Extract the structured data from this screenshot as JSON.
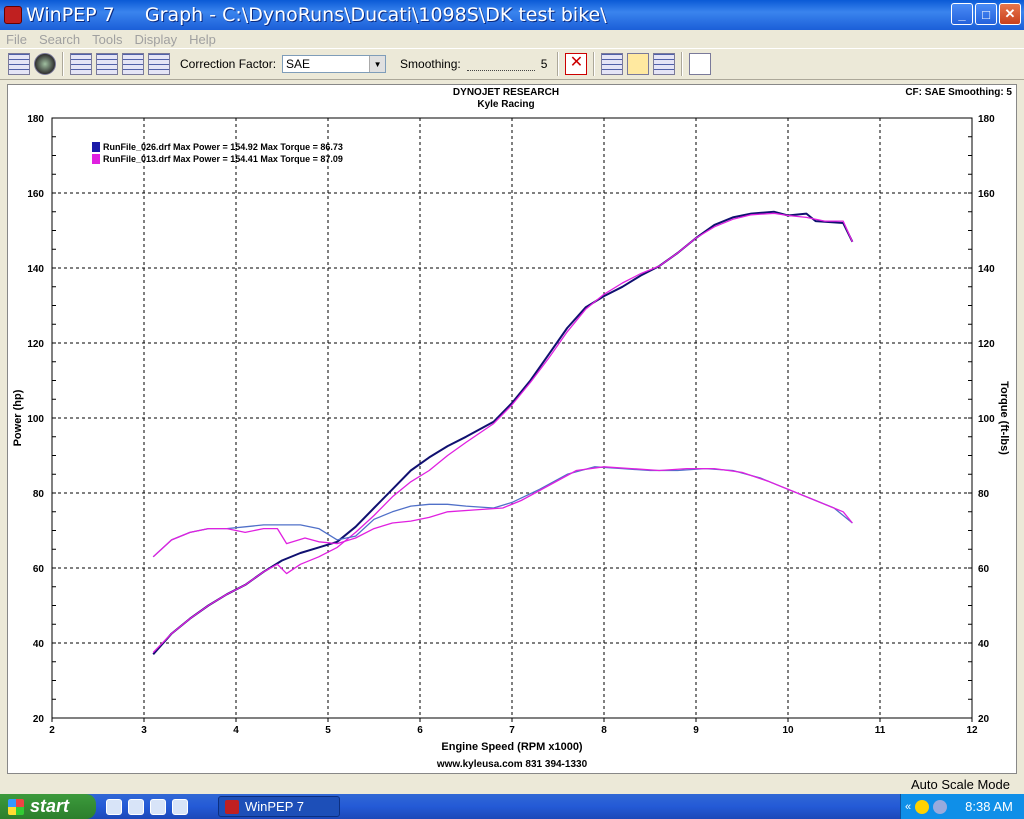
{
  "window": {
    "title": "WinPEP 7     Graph - C:\\DynoRuns\\Ducati\\1098S\\DK test bike\\",
    "minimize": "_",
    "maximize": "□",
    "close": "✕"
  },
  "menu": [
    "File",
    "Search",
    "Tools",
    "Display",
    "Help"
  ],
  "toolbar": {
    "correction_label": "Correction Factor:",
    "correction_value": "SAE",
    "smoothing_label": "Smoothing:",
    "smoothing_value": "5"
  },
  "chart_data": {
    "type": "line",
    "title": "DYNOJET RESEARCH",
    "subtitle": "Kyle Racing",
    "info_right": "CF: SAE  Smoothing: 5",
    "xlabel": "Engine Speed (RPM x1000)",
    "ylabel": "Power (hp)",
    "ylabel_right": "Torque (ft-lbs)",
    "footer": "www.kyleusa.com   831 394-1330",
    "xlim": [
      2,
      12
    ],
    "ylim": [
      20,
      180
    ],
    "xticks": [
      2,
      3,
      4,
      5,
      6,
      7,
      8,
      9,
      10,
      11,
      12
    ],
    "yticks": [
      20,
      40,
      60,
      80,
      100,
      120,
      140,
      160,
      180
    ],
    "grid": true,
    "legend_position": "top-left",
    "legend": [
      {
        "label": "RunFile_026.drf Max Power = 154.92 Max Torque = 86.73",
        "color": "#1a1aa8"
      },
      {
        "label": "RunFile_013.drf Max Power = 154.41 Max Torque = 87.09",
        "color": "#e020e0"
      }
    ],
    "series": [
      {
        "name": "RunFile_026.drf Power",
        "color": "#101070",
        "points": [
          [
            3.1,
            37
          ],
          [
            3.3,
            42.5
          ],
          [
            3.5,
            46.5
          ],
          [
            3.7,
            50
          ],
          [
            3.9,
            53
          ],
          [
            4.1,
            55.5
          ],
          [
            4.3,
            59
          ],
          [
            4.5,
            62
          ],
          [
            4.7,
            64
          ],
          [
            4.9,
            65.5
          ],
          [
            5.1,
            67
          ],
          [
            5.3,
            71
          ],
          [
            5.5,
            76
          ],
          [
            5.7,
            81
          ],
          [
            5.9,
            86
          ],
          [
            6.1,
            89.5
          ],
          [
            6.3,
            92.5
          ],
          [
            6.5,
            95
          ],
          [
            6.8,
            99
          ],
          [
            7.0,
            104
          ],
          [
            7.2,
            110
          ],
          [
            7.4,
            117
          ],
          [
            7.6,
            124
          ],
          [
            7.8,
            129.5
          ],
          [
            8.0,
            132.5
          ],
          [
            8.2,
            135
          ],
          [
            8.4,
            138
          ],
          [
            8.6,
            140.5
          ],
          [
            8.8,
            144
          ],
          [
            9.0,
            148
          ],
          [
            9.2,
            151.5
          ],
          [
            9.4,
            153.5
          ],
          [
            9.6,
            154.5
          ],
          [
            9.85,
            155
          ],
          [
            10.0,
            154
          ],
          [
            10.2,
            154.5
          ],
          [
            10.3,
            152.5
          ],
          [
            10.6,
            152
          ],
          [
            10.7,
            147
          ]
        ]
      },
      {
        "name": "RunFile_013.drf Power",
        "color": "#e020e0",
        "points": [
          [
            3.1,
            37.5
          ],
          [
            3.3,
            42.5
          ],
          [
            3.5,
            46.5
          ],
          [
            3.7,
            50
          ],
          [
            3.9,
            53
          ],
          [
            4.1,
            55.5
          ],
          [
            4.3,
            59
          ],
          [
            4.45,
            61
          ],
          [
            4.55,
            58.5
          ],
          [
            4.7,
            61
          ],
          [
            4.9,
            63
          ],
          [
            5.1,
            65.5
          ],
          [
            5.3,
            69.5
          ],
          [
            5.5,
            74
          ],
          [
            5.7,
            79
          ],
          [
            5.9,
            83
          ],
          [
            6.1,
            86
          ],
          [
            6.3,
            90
          ],
          [
            6.5,
            93.5
          ],
          [
            6.8,
            98.5
          ],
          [
            7.0,
            103.5
          ],
          [
            7.2,
            109.5
          ],
          [
            7.4,
            116
          ],
          [
            7.6,
            123
          ],
          [
            7.8,
            129
          ],
          [
            8.0,
            133
          ],
          [
            8.2,
            136
          ],
          [
            8.4,
            138.5
          ],
          [
            8.6,
            140.5
          ],
          [
            8.8,
            144
          ],
          [
            9.0,
            148
          ],
          [
            9.2,
            151
          ],
          [
            9.4,
            153
          ],
          [
            9.6,
            154.2
          ],
          [
            9.85,
            154.6
          ],
          [
            10.0,
            154
          ],
          [
            10.2,
            153.5
          ],
          [
            10.4,
            152.5
          ],
          [
            10.6,
            152.5
          ],
          [
            10.7,
            147
          ]
        ]
      },
      {
        "name": "RunFile_026.drf Torque",
        "color": "#5070c8",
        "points": [
          [
            3.1,
            63
          ],
          [
            3.3,
            67.5
          ],
          [
            3.5,
            69.5
          ],
          [
            3.7,
            70.5
          ],
          [
            3.9,
            70.5
          ],
          [
            4.1,
            71
          ],
          [
            4.3,
            71.5
          ],
          [
            4.5,
            71.5
          ],
          [
            4.7,
            71.5
          ],
          [
            4.9,
            70.5
          ],
          [
            5.1,
            67.5
          ],
          [
            5.3,
            68.5
          ],
          [
            5.5,
            73
          ],
          [
            5.7,
            75
          ],
          [
            5.9,
            76.5
          ],
          [
            6.1,
            77
          ],
          [
            6.3,
            77
          ],
          [
            6.5,
            76.5
          ],
          [
            6.8,
            76
          ],
          [
            7.0,
            77.5
          ],
          [
            7.3,
            81
          ],
          [
            7.6,
            85
          ],
          [
            7.9,
            87
          ],
          [
            8.2,
            86.5
          ],
          [
            8.5,
            86
          ],
          [
            8.8,
            86
          ],
          [
            9.1,
            86.5
          ],
          [
            9.4,
            86
          ],
          [
            9.7,
            84
          ],
          [
            10.0,
            81
          ],
          [
            10.3,
            78
          ],
          [
            10.5,
            76
          ],
          [
            10.7,
            72
          ]
        ]
      },
      {
        "name": "RunFile_013.drf Torque",
        "color": "#e020e0",
        "points": [
          [
            3.1,
            63
          ],
          [
            3.3,
            67.5
          ],
          [
            3.5,
            69.5
          ],
          [
            3.7,
            70.5
          ],
          [
            3.9,
            70.5
          ],
          [
            4.1,
            69.5
          ],
          [
            4.3,
            70.5
          ],
          [
            4.45,
            70.5
          ],
          [
            4.55,
            66.5
          ],
          [
            4.75,
            68
          ],
          [
            4.9,
            67
          ],
          [
            5.1,
            66.5
          ],
          [
            5.3,
            68
          ],
          [
            5.5,
            70.5
          ],
          [
            5.7,
            72
          ],
          [
            5.9,
            72.5
          ],
          [
            6.1,
            73.5
          ],
          [
            6.3,
            75
          ],
          [
            6.6,
            75.5
          ],
          [
            6.9,
            76
          ],
          [
            7.1,
            78
          ],
          [
            7.4,
            82
          ],
          [
            7.7,
            86
          ],
          [
            8.0,
            87
          ],
          [
            8.3,
            86.5
          ],
          [
            8.6,
            86
          ],
          [
            8.9,
            86.5
          ],
          [
            9.2,
            86.5
          ],
          [
            9.5,
            85.5
          ],
          [
            9.8,
            83
          ],
          [
            10.1,
            80
          ],
          [
            10.4,
            77
          ],
          [
            10.6,
            75
          ],
          [
            10.7,
            72
          ]
        ]
      }
    ]
  },
  "status": {
    "mode": "Auto Scale Mode"
  },
  "taskbar": {
    "start": "start",
    "task": "WinPEP 7",
    "clock": "8:38 AM"
  }
}
